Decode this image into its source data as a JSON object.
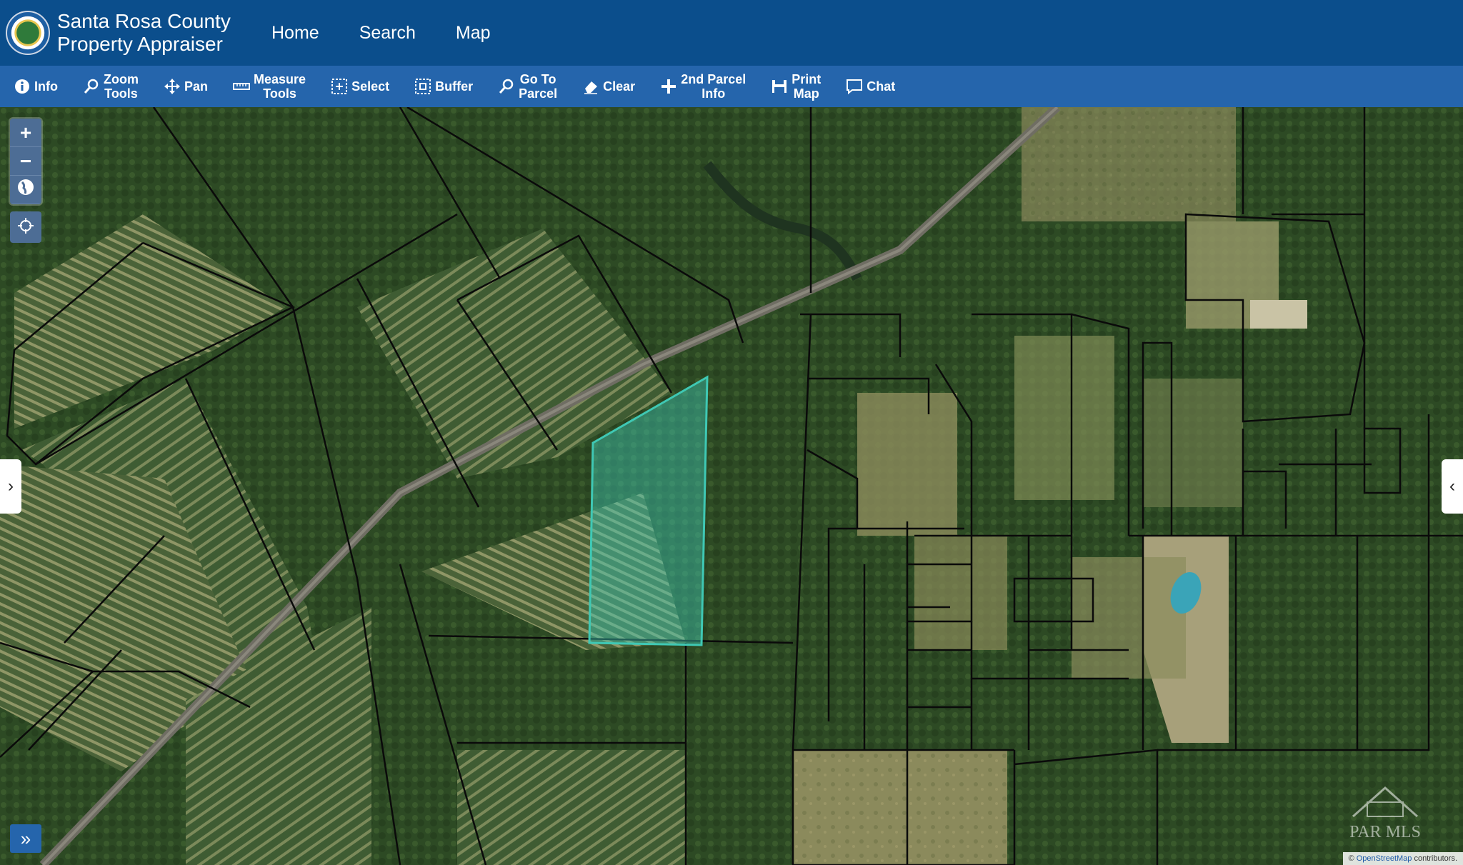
{
  "header": {
    "brand_line1": "Santa Rosa County",
    "brand_line2": "Property Appraiser",
    "nav": [
      "Home",
      "Search",
      "Map"
    ]
  },
  "toolbar": {
    "items": [
      {
        "label": "Info",
        "icon": "info-icon"
      },
      {
        "label": "Zoom\nTools",
        "icon": "magnifier-icon"
      },
      {
        "label": "Pan",
        "icon": "pan-arrows-icon"
      },
      {
        "label": "Measure\nTools",
        "icon": "ruler-icon"
      },
      {
        "label": "Select",
        "icon": "select-box-icon"
      },
      {
        "label": "Buffer",
        "icon": "buffer-icon"
      },
      {
        "label": "Go To\nParcel",
        "icon": "goto-parcel-icon"
      },
      {
        "label": "Clear",
        "icon": "eraser-icon"
      },
      {
        "label": "2nd Parcel\nInfo",
        "icon": "plus-icon"
      },
      {
        "label": "Print\nMap",
        "icon": "printer-icon"
      },
      {
        "label": "Chat",
        "icon": "chat-bubble-icon"
      }
    ]
  },
  "map": {
    "zoom_in": "+",
    "zoom_out": "−",
    "expand": "»",
    "left_toggle": "›",
    "right_toggle": "‹",
    "attribution_prefix": "©",
    "attribution_link": "OpenStreetMap",
    "attribution_suffix": "contributors.",
    "watermark": "PAR MLS",
    "highlight_color": "#3fc8b4"
  }
}
